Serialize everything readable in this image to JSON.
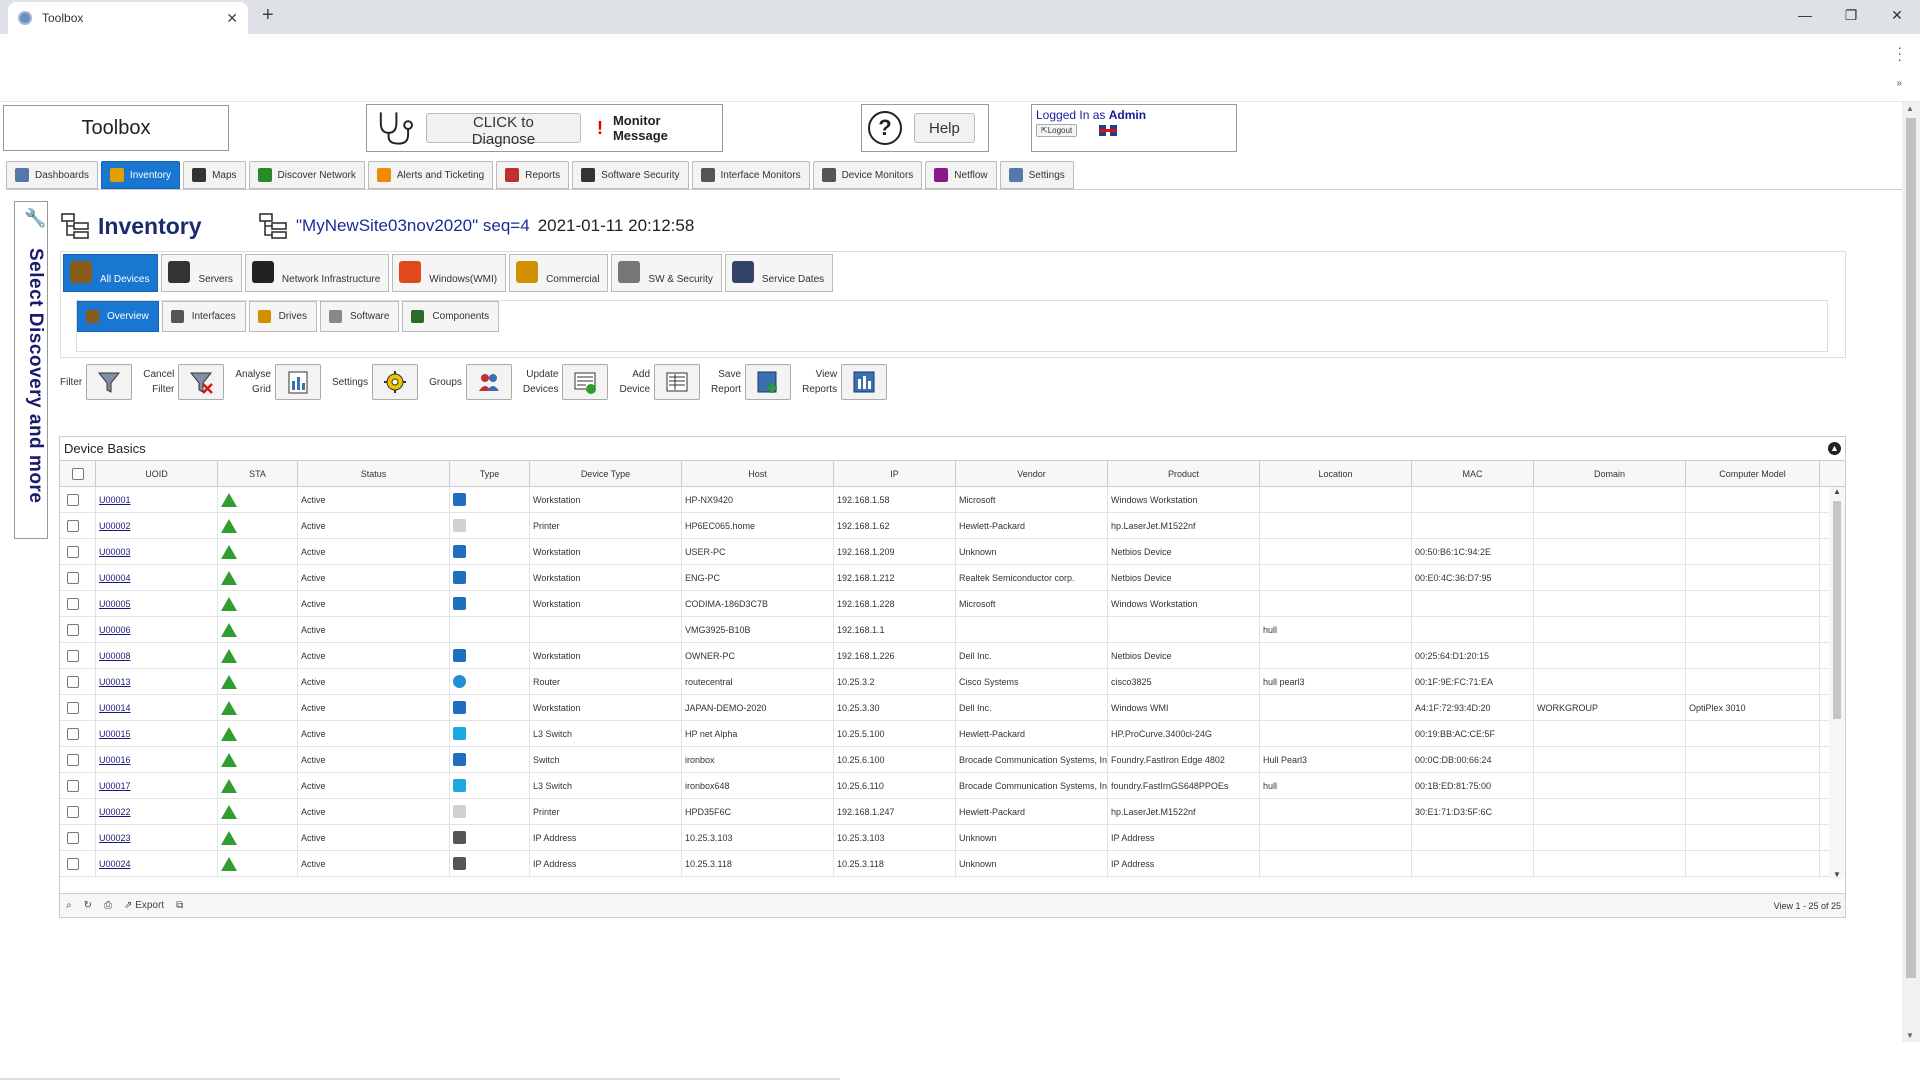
{
  "browser": {
    "tab_title": "Toolbox",
    "tab_close": "✕",
    "new_tab": "+",
    "controls": [
      "—",
      "❐",
      "✕"
    ]
  },
  "header": {
    "brand": "Toolbox",
    "diagnose_button": "CLICK to Diagnose",
    "monitor_message": "Monitor Message",
    "help_button": "Help",
    "logged_in_prefix": "Logged In as",
    "user": "Admin",
    "logout": "Logout"
  },
  "main_tabs": [
    {
      "label": "Dashboards",
      "icon": "dashboard-icon",
      "color": "#5577aa"
    },
    {
      "label": "Inventory",
      "icon": "inventory-icon",
      "color": "#e0a000",
      "active": true
    },
    {
      "label": "Maps",
      "icon": "map-icon",
      "color": "#333333"
    },
    {
      "label": "Discover Network",
      "icon": "discover-icon",
      "color": "#2a8a2a"
    },
    {
      "label": "Alerts and Ticketing",
      "icon": "alert-icon",
      "color": "#f08a00"
    },
    {
      "label": "Reports",
      "icon": "reports-icon",
      "color": "#c03030"
    },
    {
      "label": "Software Security",
      "icon": "software-security-icon",
      "color": "#333333"
    },
    {
      "label": "Interface Monitors",
      "icon": "interface-monitor-icon",
      "color": "#555555"
    },
    {
      "label": "Device Monitors",
      "icon": "device-monitor-icon",
      "color": "#555555"
    },
    {
      "label": "Netflow",
      "icon": "netflow-icon",
      "color": "#8a1a8a"
    },
    {
      "label": "Settings",
      "icon": "settings-icon",
      "color": "#5577aa"
    }
  ],
  "side_tab": "Select Discovery and more",
  "page": {
    "title": "Inventory",
    "site": "\"MyNewSite03nov2020\" seq=4",
    "timestamp": "2021-01-11 20:12:58"
  },
  "category_tabs": [
    {
      "label": "All Devices",
      "icon": "all-devices-icon",
      "color": "#8a5a1a",
      "active": true
    },
    {
      "label": "Servers",
      "icon": "server-icon",
      "color": "#333333"
    },
    {
      "label": "Network Infrastructure",
      "icon": "network-infrastructure-icon",
      "color": "#222222"
    },
    {
      "label": "Windows(WMI)",
      "icon": "windows-icon",
      "color": "#e04a1a"
    },
    {
      "label": "Commercial",
      "icon": "commercial-icon",
      "color": "#d09000"
    },
    {
      "label": "SW & Security",
      "icon": "sw-security-icon",
      "color": "#777777"
    },
    {
      "label": "Service Dates",
      "icon": "service-dates-icon",
      "color": "#334466"
    }
  ],
  "sub_tabs": [
    {
      "label": "Overview",
      "icon": "overview-icon",
      "color": "#8a5a1a",
      "active": true
    },
    {
      "label": "Interfaces",
      "icon": "interfaces-icon",
      "color": "#555555"
    },
    {
      "label": "Drives",
      "icon": "drives-icon",
      "color": "#d09000"
    },
    {
      "label": "Software",
      "icon": "software-icon",
      "color": "#888888"
    },
    {
      "label": "Components",
      "icon": "components-icon",
      "color": "#2a6a2a"
    }
  ],
  "toolbar": [
    {
      "label": "Filter",
      "icon": "filter-icon"
    },
    {
      "label": "Cancel\nFilter",
      "icon": "cancel-filter-icon"
    },
    {
      "label": "Analyse\nGrid",
      "icon": "analyse-grid-icon"
    },
    {
      "label": "Settings",
      "icon": "settings-gear-icon"
    },
    {
      "label": "Groups",
      "icon": "groups-icon"
    },
    {
      "label": "Update\nDevices",
      "icon": "update-devices-icon"
    },
    {
      "label": "Add\nDevice",
      "icon": "add-device-icon"
    },
    {
      "label": "Save\nReport",
      "icon": "save-report-icon"
    },
    {
      "label": "View\nReports",
      "icon": "view-reports-icon"
    }
  ],
  "grid": {
    "caption": "Device Basics",
    "columns": [
      "UOID",
      "STA",
      "Status",
      "Type",
      "Device Type",
      "Host",
      "IP",
      "Vendor",
      "Product",
      "Location",
      "MAC",
      "Domain",
      "Computer Model"
    ],
    "rows": [
      {
        "uoid": "U00001",
        "status": "Active",
        "type_icon": "workstation-icon",
        "device_type": "Workstation",
        "host": "HP-NX9420",
        "ip": "192.168.1.58",
        "vendor": "Microsoft",
        "product": "Windows Workstation",
        "location": "",
        "mac": "",
        "domain": "",
        "model": ""
      },
      {
        "uoid": "U00002",
        "status": "Active",
        "type_icon": "printer-icon",
        "device_type": "Printer",
        "host": "HP6EC065.home",
        "ip": "192.168.1.62",
        "vendor": "Hewlett-Packard",
        "product": "hp.LaserJet.M1522nf",
        "location": "",
        "mac": "",
        "domain": "",
        "model": ""
      },
      {
        "uoid": "U00003",
        "status": "Active",
        "type_icon": "workstation-icon",
        "device_type": "Workstation",
        "host": "USER-PC",
        "ip": "192.168.1.209",
        "vendor": "Unknown",
        "product": "Netbios Device",
        "location": "",
        "mac": "00:50:B6:1C:94:2E",
        "domain": "",
        "model": ""
      },
      {
        "uoid": "U00004",
        "status": "Active",
        "type_icon": "workstation-icon",
        "device_type": "Workstation",
        "host": "ENG-PC",
        "ip": "192.168.1.212",
        "vendor": "Realtek Semiconductor corp.",
        "product": "Netbios Device",
        "location": "",
        "mac": "00:E0:4C:36:D7:95",
        "domain": "",
        "model": ""
      },
      {
        "uoid": "U00005",
        "status": "Active",
        "type_icon": "workstation-icon",
        "device_type": "Workstation",
        "host": "CODIMA-186D3C7B",
        "ip": "192.168.1.228",
        "vendor": "Microsoft",
        "product": "Windows Workstation",
        "location": "",
        "mac": "",
        "domain": "",
        "model": ""
      },
      {
        "uoid": "U00006",
        "status": "Active",
        "type_icon": "",
        "device_type": "",
        "host": "VMG3925-B10B",
        "ip": "192.168.1.1",
        "vendor": "",
        "product": "",
        "location": "hull",
        "mac": "",
        "domain": "",
        "model": ""
      },
      {
        "uoid": "U00008",
        "status": "Active",
        "type_icon": "workstation-icon",
        "device_type": "Workstation",
        "host": "OWNER-PC",
        "ip": "192.168.1.226",
        "vendor": "Dell Inc.",
        "product": "Netbios Device",
        "location": "",
        "mac": "00:25:64:D1:20:15",
        "domain": "",
        "model": ""
      },
      {
        "uoid": "U00013",
        "status": "Active",
        "type_icon": "router-icon",
        "device_type": "Router",
        "host": "routecentral",
        "ip": "10.25.3.2",
        "vendor": "Cisco Systems",
        "product": "cisco3825",
        "location": "hull pearl3",
        "mac": "00:1F:9E:FC:71:EA",
        "domain": "",
        "model": ""
      },
      {
        "uoid": "U00014",
        "status": "Active",
        "type_icon": "workstation-icon",
        "device_type": "Workstation",
        "host": "JAPAN-DEMO-2020",
        "ip": "10.25.3.30",
        "vendor": "Dell Inc.",
        "product": "Windows WMI",
        "location": "",
        "mac": "A4:1F:72:93:4D:20",
        "domain": "WORKGROUP",
        "model": "OptiPlex 3010"
      },
      {
        "uoid": "U00015",
        "status": "Active",
        "type_icon": "l3-switch-icon",
        "device_type": "L3 Switch",
        "host": "HP net Alpha",
        "ip": "10.25.5.100",
        "vendor": "Hewlett-Packard",
        "product": "HP.ProCurve.3400cl-24G",
        "location": "",
        "mac": "00:19:BB:AC:CE:5F",
        "domain": "",
        "model": ""
      },
      {
        "uoid": "U00016",
        "status": "Active",
        "type_icon": "switch-icon",
        "device_type": "Switch",
        "host": "ironbox",
        "ip": "10.25.6.100",
        "vendor": "Brocade Communication Systems, Inc.",
        "product": "Foundry.FastIron Edge 4802",
        "location": "Hull Pearl3",
        "mac": "00:0C:DB:00:66:24",
        "domain": "",
        "model": ""
      },
      {
        "uoid": "U00017",
        "status": "Active",
        "type_icon": "l3-switch-icon",
        "device_type": "L3 Switch",
        "host": "ironbox648",
        "ip": "10.25.6.110",
        "vendor": "Brocade Communication Systems, Inc.",
        "product": "foundry.FastIrnGS648PPOEs",
        "location": "hull",
        "mac": "00:1B:ED:81:75:00",
        "domain": "",
        "model": ""
      },
      {
        "uoid": "U00022",
        "status": "Active",
        "type_icon": "printer-icon",
        "device_type": "Printer",
        "host": "HPD35F6C",
        "ip": "192.168.1.247",
        "vendor": "Hewlett-Packard",
        "product": "hp.LaserJet.M1522nf",
        "location": "",
        "mac": "30:E1:71:D3:5F:6C",
        "domain": "",
        "model": ""
      },
      {
        "uoid": "U00023",
        "status": "Active",
        "type_icon": "ip-address-icon",
        "device_type": "IP Address",
        "host": "10.25.3.103",
        "ip": "10.25.3.103",
        "vendor": "Unknown",
        "product": "IP Address",
        "location": "",
        "mac": "",
        "domain": "",
        "model": ""
      },
      {
        "uoid": "U00024",
        "status": "Active",
        "type_icon": "ip-address-icon",
        "device_type": "IP Address",
        "host": "10.25.3.118",
        "ip": "10.25.3.118",
        "vendor": "Unknown",
        "product": "IP Address",
        "location": "",
        "mac": "",
        "domain": "",
        "model": ""
      }
    ],
    "footer_export": "Export",
    "view_count": "View 1 - 25 of 25"
  }
}
